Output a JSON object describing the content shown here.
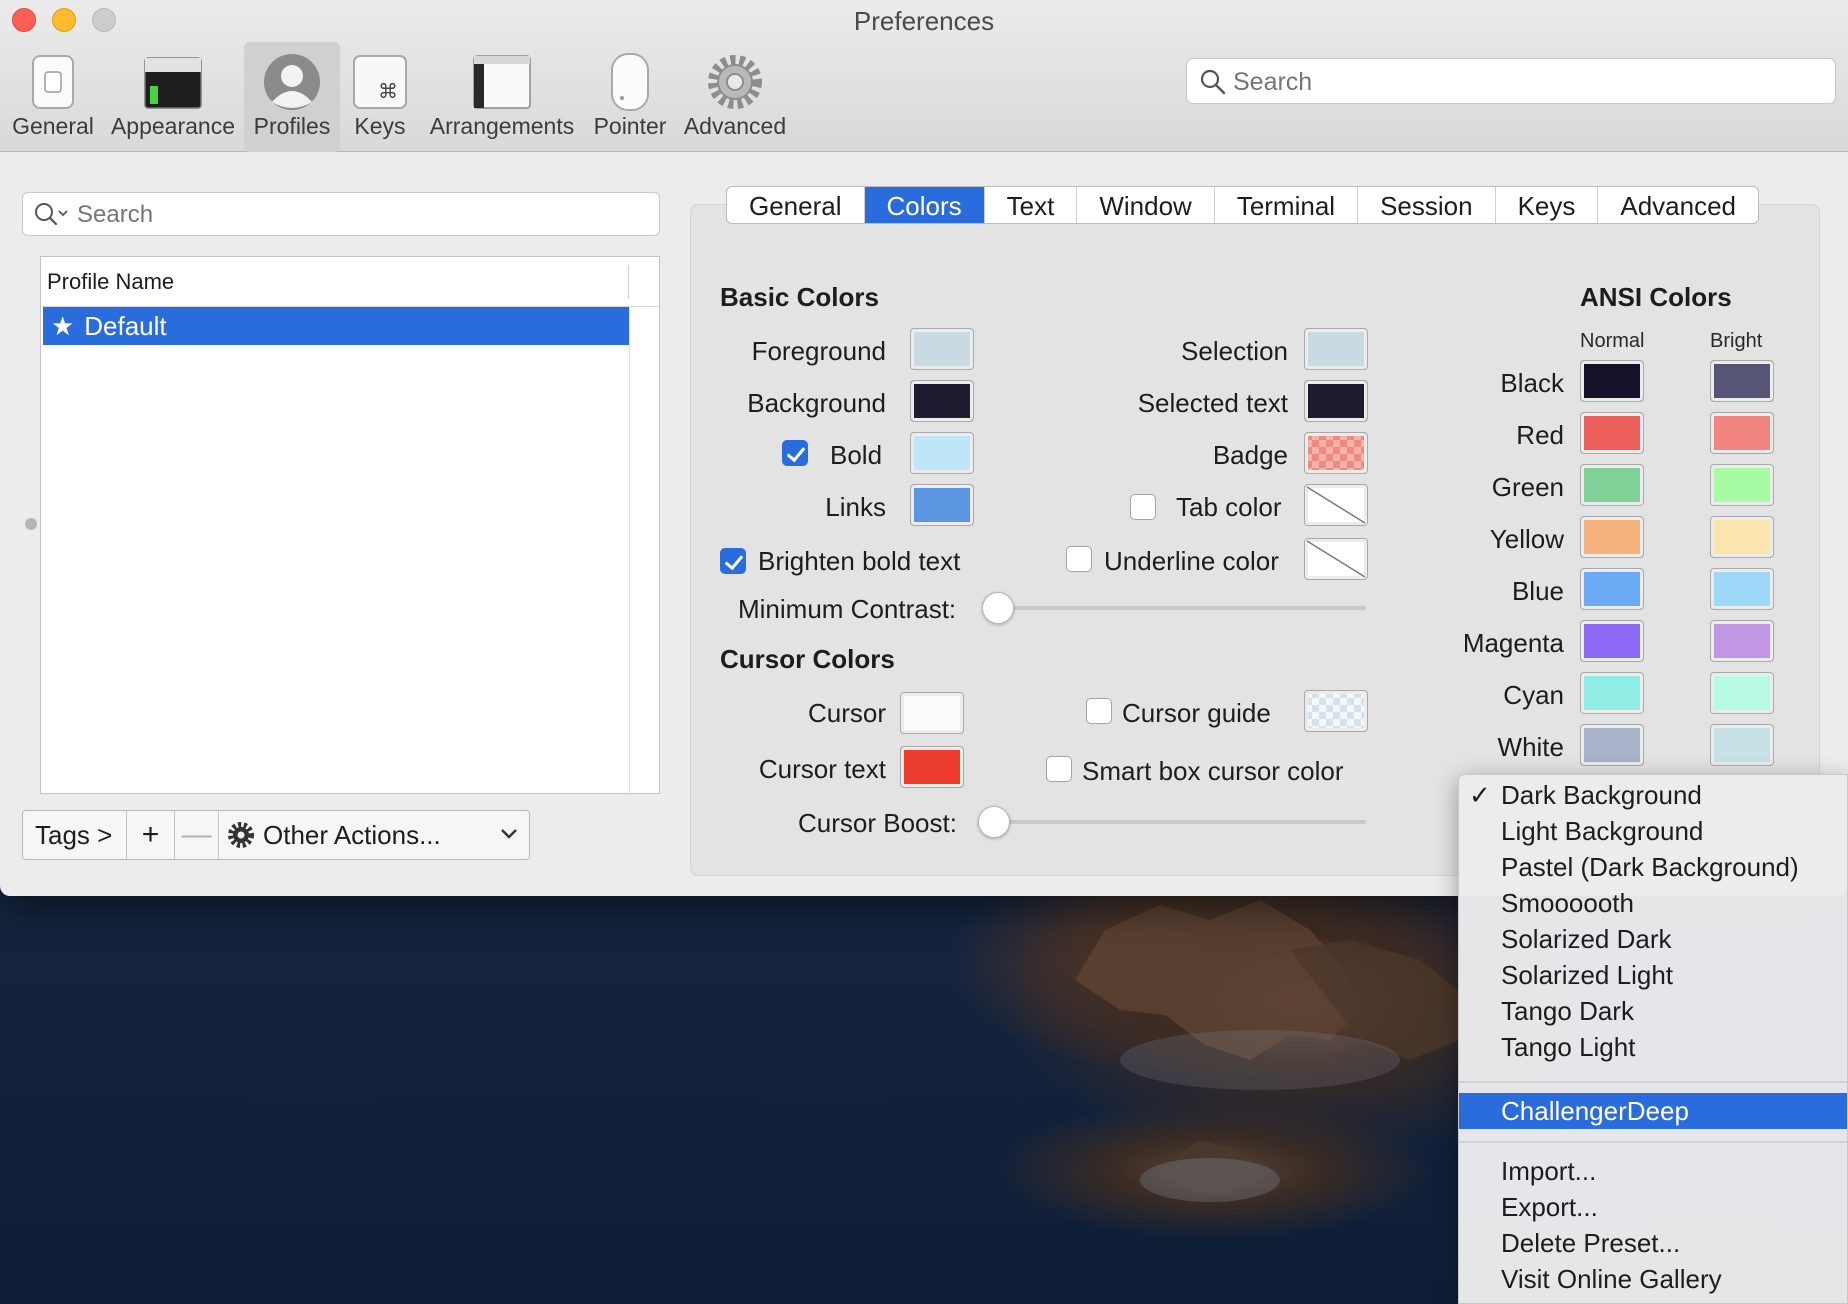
{
  "window": {
    "title": "Preferences"
  },
  "toolbar": {
    "items": [
      {
        "label": "General",
        "icon": "general-switch-icon"
      },
      {
        "label": "Appearance",
        "icon": "appearance-window-icon"
      },
      {
        "label": "Profiles",
        "icon": "profile-user-icon",
        "active": true
      },
      {
        "label": "Keys",
        "icon": "command-key-icon"
      },
      {
        "label": "Arrangements",
        "icon": "arrangements-window-icon"
      },
      {
        "label": "Pointer",
        "icon": "mouse-icon"
      },
      {
        "label": "Advanced",
        "icon": "gear-icon"
      }
    ],
    "search_placeholder": "Search"
  },
  "profiles": {
    "search_placeholder": "Search",
    "column_header": "Profile Name",
    "rows": [
      {
        "name": "Default",
        "icon": "star-icon",
        "selected": true
      }
    ],
    "tags_label": "Tags >",
    "add_label": "+",
    "remove_label": "—",
    "actions_label": "Other Actions..."
  },
  "tabs": {
    "items": [
      "General",
      "Colors",
      "Text",
      "Window",
      "Terminal",
      "Session",
      "Keys",
      "Advanced"
    ],
    "active": "Colors"
  },
  "basic_colors": {
    "title": "Basic Colors",
    "foreground_label": "Foreground",
    "background_label": "Background",
    "bold_label": "Bold",
    "links_label": "Links",
    "selection_label": "Selection",
    "selected_text_label": "Selected text",
    "badge_label": "Badge",
    "tab_color_label": "Tab color",
    "underline_color_label": "Underline color",
    "brighten_bold_label": "Brighten bold text",
    "min_contrast_label": "Minimum Contrast:",
    "min_contrast_value": 0,
    "bold_checked": true,
    "brighten_bold_checked": true,
    "tab_color_checked": false,
    "underline_color_checked": false,
    "colors": {
      "foreground": "#c9dae3",
      "background": "#1e1c31",
      "bold": "#bfe6f8",
      "links": "#5a95e0",
      "selection": "#c9dae3",
      "selected_text": "#1e1c31"
    }
  },
  "cursor_colors": {
    "title": "Cursor Colors",
    "cursor_label": "Cursor",
    "cursor_text_label": "Cursor text",
    "cursor_guide_label": "Cursor guide",
    "smart_box_label": "Smart box cursor color",
    "cursor_boost_label": "Cursor Boost:",
    "cursor_boost_value": 0,
    "cursor_guide_checked": false,
    "smart_box_checked": false,
    "colors": {
      "cursor": "#fbfbfb",
      "cursor_text": "#ec3d2f"
    }
  },
  "ansi_colors": {
    "title": "ANSI Colors",
    "normal_label": "Normal",
    "bright_label": "Bright",
    "rows": [
      {
        "name": "Black",
        "normal": "#141228",
        "bright": "#565575"
      },
      {
        "name": "Red",
        "normal": "#ec5f5c",
        "bright": "#f38581"
      },
      {
        "name": "Green",
        "normal": "#7fd197",
        "bright": "#a7fca3"
      },
      {
        "name": "Yellow",
        "normal": "#f4b37d",
        "bright": "#fae6ac"
      },
      {
        "name": "Blue",
        "normal": "#6ca9f5",
        "bright": "#9dd8f8"
      },
      {
        "name": "Magenta",
        "normal": "#8c6af5",
        "bright": "#c196e2"
      },
      {
        "name": "Cyan",
        "normal": "#8fede6",
        "bright": "#b6fae3"
      },
      {
        "name": "White",
        "normal": "#a8b2c9",
        "bright": "#c7e1e7"
      }
    ]
  },
  "preset_menu": {
    "items": [
      {
        "label": "Dark Background",
        "checked": true
      },
      {
        "label": "Light Background"
      },
      {
        "label": "Pastel (Dark Background)"
      },
      {
        "label": "Smoooooth"
      },
      {
        "label": "Solarized Dark"
      },
      {
        "label": "Solarized Light"
      },
      {
        "label": "Tango Dark"
      },
      {
        "label": "Tango Light"
      }
    ],
    "custom_items": [
      {
        "label": "ChallengerDeep",
        "highlighted": true
      }
    ],
    "action_items": [
      {
        "label": "Import..."
      },
      {
        "label": "Export..."
      },
      {
        "label": "Delete Preset..."
      },
      {
        "label": "Visit Online Gallery"
      }
    ]
  }
}
